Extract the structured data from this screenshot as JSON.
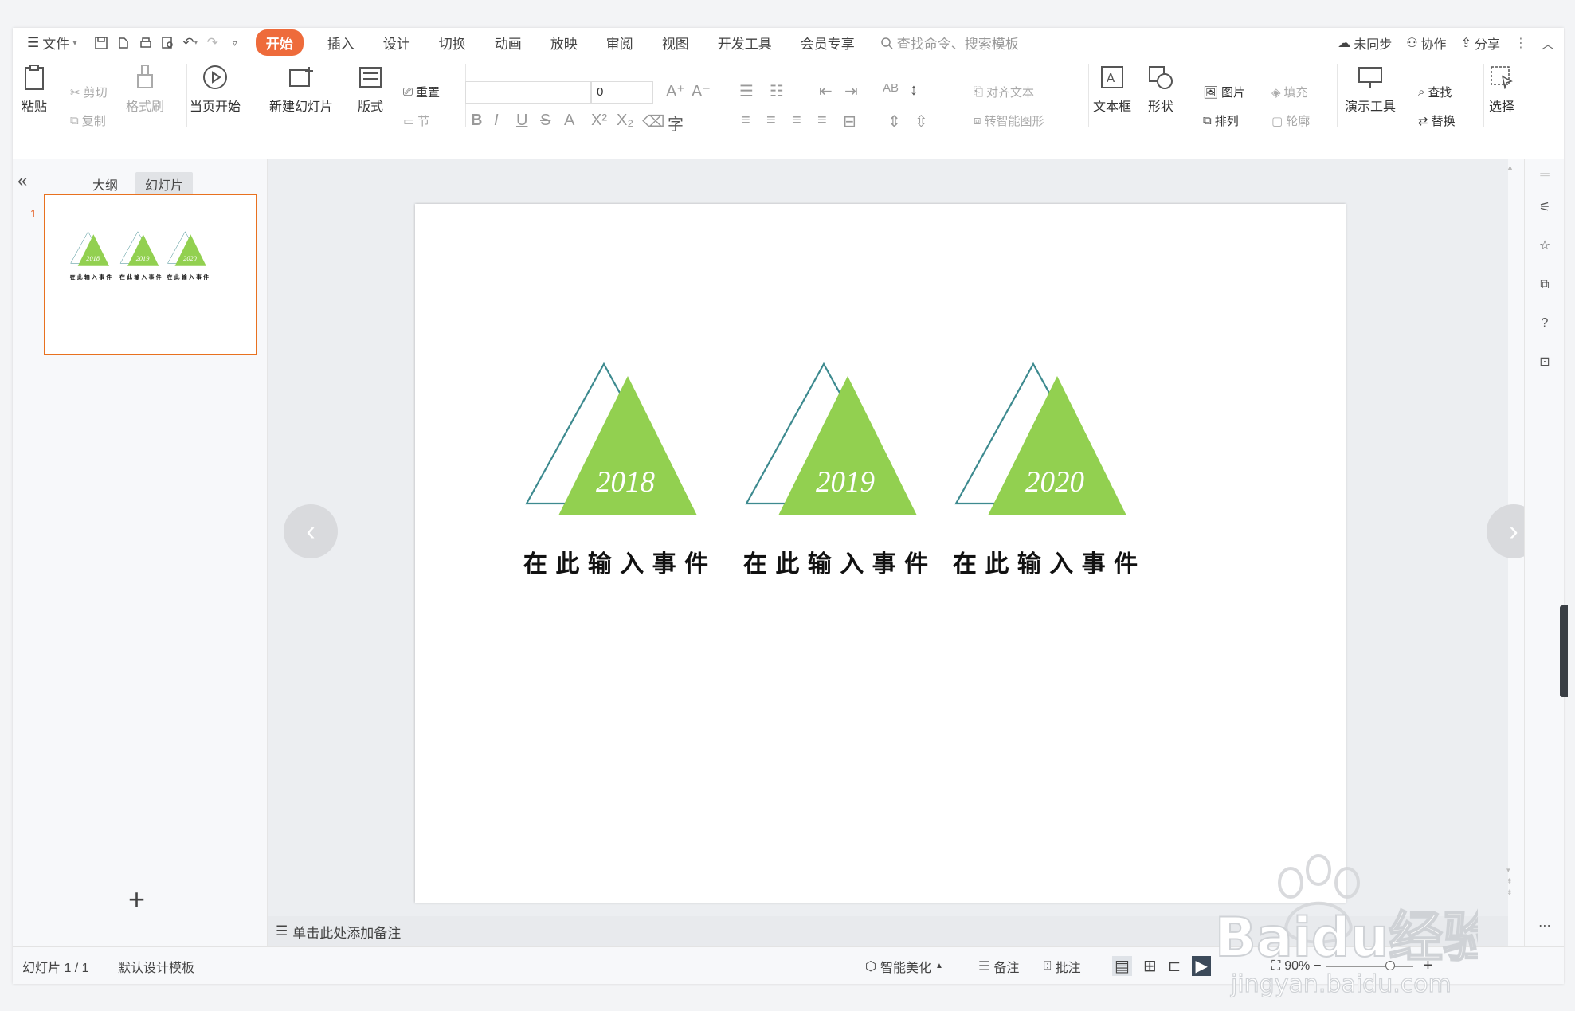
{
  "menu": {
    "file_label": "文件",
    "tabs": [
      "开始",
      "插入",
      "设计",
      "切换",
      "动画",
      "放映",
      "审阅",
      "视图",
      "开发工具",
      "会员专享"
    ],
    "active_tab": "开始",
    "search_placeholder": "查找命令、搜索模板",
    "right": {
      "sync": "未同步",
      "collab": "协作",
      "share": "分享"
    }
  },
  "ribbon": {
    "paste": "粘贴",
    "cut": "剪切",
    "copy": "复制",
    "format_painter": "格式刷",
    "play_from_current": "当页开始",
    "new_slide": "新建幻灯片",
    "layout": "版式",
    "reset": "重置",
    "section": "节",
    "font_size": "0",
    "align_text": "对齐文本",
    "smartart": "转智能图形",
    "textbox": "文本框",
    "shapes": "形状",
    "picture": "图片",
    "fill": "填充",
    "arrange": "排列",
    "outline": "轮廓",
    "present_tools": "演示工具",
    "find": "查找",
    "replace": "替换",
    "select": "选择"
  },
  "left_panel": {
    "tab_outline": "大纲",
    "tab_slides": "幻灯片",
    "thumb_number": "1"
  },
  "slide": {
    "items": [
      {
        "year": "2018",
        "caption": "在 此 输 入 事 件"
      },
      {
        "year": "2019",
        "caption": "在 此 输 入 事 件"
      },
      {
        "year": "2020",
        "caption": "在 此 输 入 事 件"
      }
    ],
    "colors": {
      "fill": "#92d050",
      "outline": "#3d8a8f",
      "caption": "#111111"
    }
  },
  "notes": {
    "placeholder": "单击此处添加备注"
  },
  "status": {
    "slide_counter": "幻灯片 1 / 1",
    "template": "默认设计模板",
    "beautify": "智能美化",
    "notes": "备注",
    "comments": "批注",
    "zoom": "90%"
  },
  "watermark": {
    "brand": "Baidu经验",
    "url": "jingyan.baidu.com"
  }
}
